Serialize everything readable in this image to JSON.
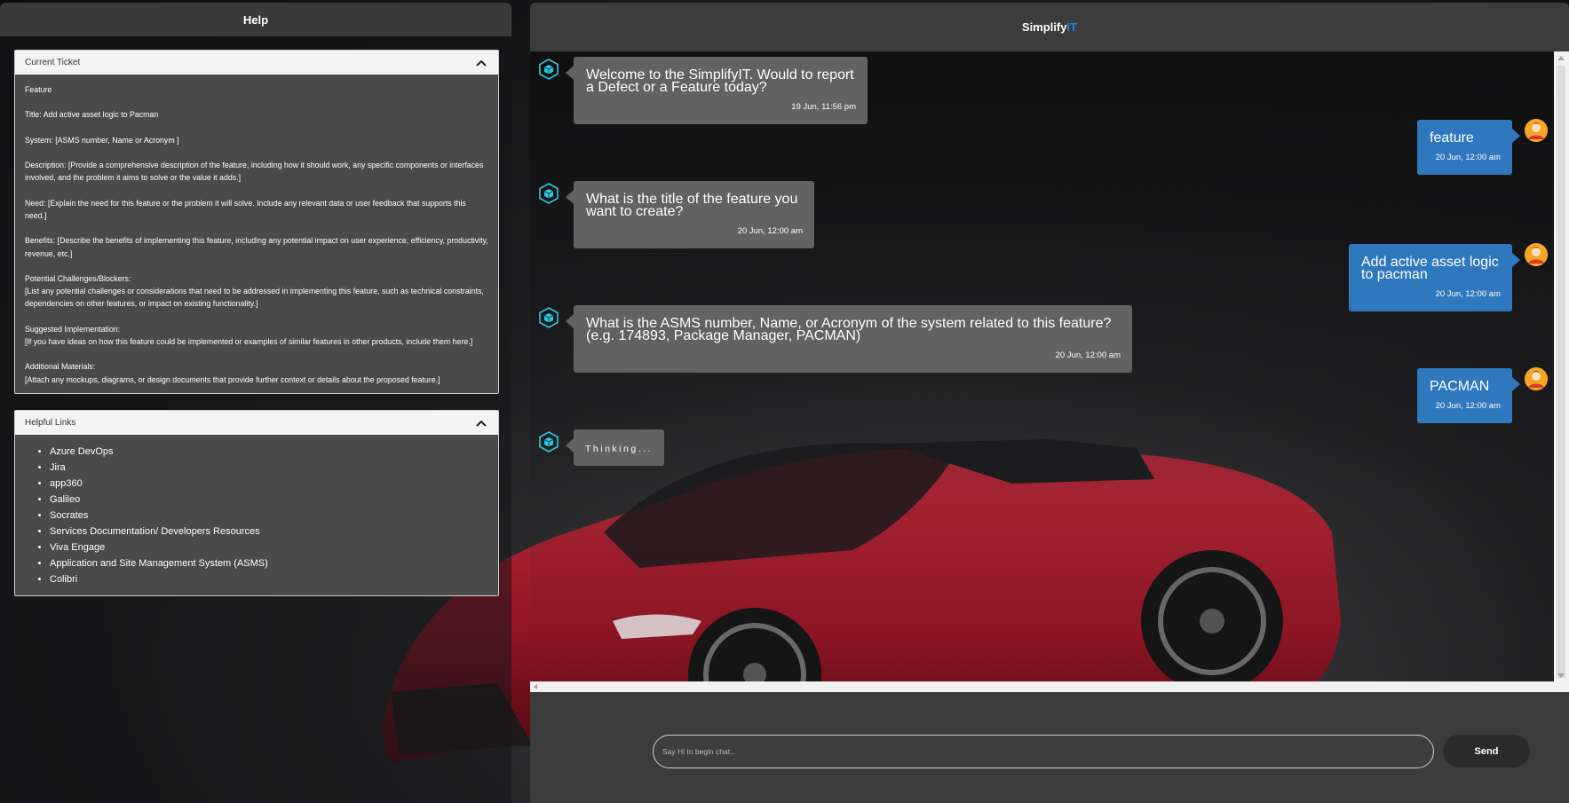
{
  "help": {
    "title": "Help",
    "current_ticket": {
      "header": "Current Ticket",
      "lines": [
        "Feature",
        "Title: Add active asset logic to Pacman",
        "System: [ASMS number, Name or Acronym ]",
        "Description: [Provide a comprehensive description of the feature, including how it should work, any specific components or interfaces involved, and the problem it aims to solve or the value it adds.]",
        "Need: [Explain the need for this feature or the problem it will solve. Include any relevant data or user feedback that supports this need.]",
        "Benefits: [Describe the benefits of implementing this feature, including any potential impact on user experience, efficiency, productivity, revenue, etc.]",
        "Potential Challenges/Blockers:",
        "[List any potential challenges or considerations that need to be addressed in implementing this feature, such as technical constraints, dependencies on other features, or impact on existing functionality.]",
        "Suggested Implementation:",
        "[If you have ideas on how this feature could be implemented or examples of similar features in other products, include them here.]",
        "Additional Materials:",
        "[Attach any mockups, diagrams, or design documents that provide further context or details about the proposed feature.]"
      ]
    },
    "helpful_links": {
      "header": "Helpful Links",
      "items": [
        "Azure DevOps",
        "Jira",
        "app360",
        "Galileo",
        "Socrates",
        "Services Documentation/ Developers Resources",
        "Viva Engage",
        "Application and Site Management System (ASMS)",
        "Colibri"
      ]
    }
  },
  "chat": {
    "brand_main": "Simplify",
    "brand_accent": "IT",
    "accent_color": "#1e88e5",
    "messages": [
      {
        "sender": "bot",
        "text": "Welcome to the SimplifyIT. Would to report a Defect or a Feature today?",
        "time": "19 Jun, 11:56 pm"
      },
      {
        "sender": "user",
        "text": "feature",
        "time": "20 Jun, 12:00 am"
      },
      {
        "sender": "bot",
        "text": "What is the title of the feature you want to create?",
        "time": "20 Jun, 12:00 am"
      },
      {
        "sender": "user",
        "text": "Add active asset logic to pacman",
        "time": "20 Jun, 12:00 am"
      },
      {
        "sender": "bot",
        "text": "What is the ASMS number, Name, or Acronym of the system related to this feature? (e.g. 174893, Package Manager, PACMAN)",
        "time": "20 Jun, 12:00 am"
      },
      {
        "sender": "user",
        "text": "PACMAN",
        "time": "20 Jun, 12:00 am"
      },
      {
        "sender": "bot",
        "text": "Thinking...",
        "time": ""
      }
    ],
    "input": {
      "placeholder": "Say Hi to begin chat...",
      "value": ""
    },
    "send_label": "Send"
  },
  "icons": {
    "bot": "bot-cube-icon",
    "user": "user-avatar-icon",
    "collapse": "chevron-up-icon"
  }
}
